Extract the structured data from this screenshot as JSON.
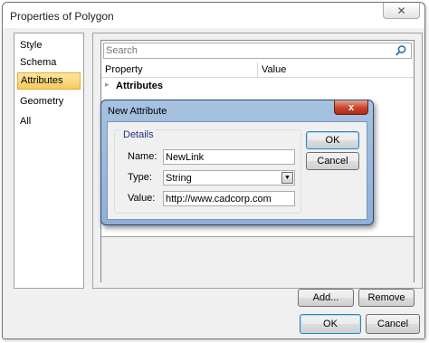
{
  "window": {
    "title": "Properties of Polygon",
    "close_glyph": "✕"
  },
  "nav": {
    "items": [
      "Style",
      "Schema",
      "Attributes",
      "Geometry",
      "All"
    ],
    "selected_index": 2
  },
  "grid": {
    "search_placeholder": "Search",
    "col_property": "Property",
    "col_value": "Value",
    "category": "Attributes"
  },
  "buttons": {
    "add": "Add...",
    "remove": "Remove",
    "ok": "OK",
    "cancel": "Cancel"
  },
  "modal": {
    "title": "New Attribute",
    "close_glyph": "x",
    "group_label": "Details",
    "name_label": "Name:",
    "name_value": "NewLink",
    "type_label": "Type:",
    "type_value": "String",
    "value_label": "Value:",
    "value_value": "http://www.cadcorp.com",
    "ok": "OK",
    "cancel": "Cancel"
  },
  "icons": {
    "search": "search-icon",
    "chevron": "chevron-right-icon",
    "dropdown": "chevron-down-icon"
  },
  "colors": {
    "selection": "#f6cb5c",
    "modal_frame": "#8fb0d8",
    "group_title": "#1e3287"
  }
}
